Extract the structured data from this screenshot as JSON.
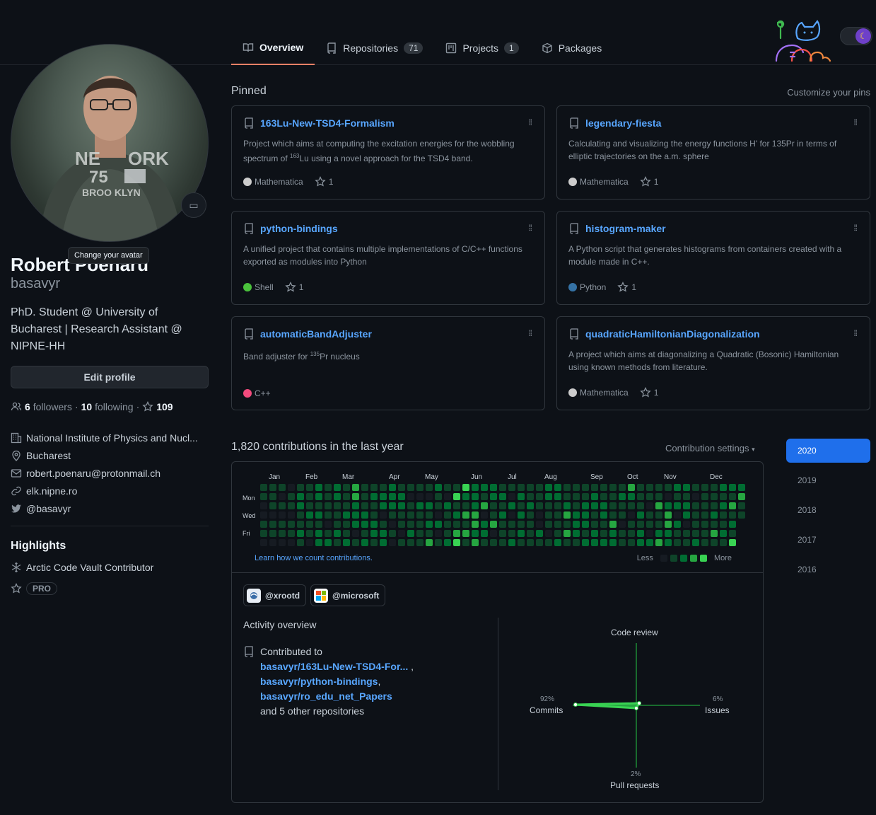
{
  "tabs": [
    {
      "label": "Overview",
      "count": ""
    },
    {
      "label": "Repositories",
      "count": "71"
    },
    {
      "label": "Projects",
      "count": "1"
    },
    {
      "label": "Packages",
      "count": ""
    }
  ],
  "profile": {
    "tooltip": "Change your avatar",
    "fullname": "Robert Poenaru",
    "username": "basavyr",
    "bio": "PhD. Student @ University of Bucharest | Research Assistant @ NIPNE-HH",
    "edit_label": "Edit profile",
    "followers": "6",
    "followers_label": "followers",
    "following": "10",
    "following_label": "following",
    "stars": "109",
    "org": "National Institute of Physics and Nucl...",
    "location": "Bucharest",
    "email": "robert.poenaru@protonmail.ch",
    "website": "elk.nipne.ro",
    "twitter": "@basavyr"
  },
  "highlights": {
    "title": "Highlights",
    "vault": "Arctic Code Vault Contributor",
    "pro": "PRO"
  },
  "pinned": {
    "title": "Pinned",
    "customize": "Customize your pins",
    "items": [
      {
        "name": "163Lu-New-TSD4-Formalism",
        "desc_a": "Project which aims at computing the excitation energies for the wobbling spectrum of ",
        "desc_sup": "163",
        "desc_b": "Lu using a novel approach for the TSD4 band.",
        "lang": "Mathematica",
        "color": "#cccccc",
        "stars": "1"
      },
      {
        "name": "legendary-fiesta",
        "desc_a": "Calculating and visualizing the energy functions H' for 135Pr in terms of elliptic trajectories on the a.m. sphere",
        "desc_sup": "",
        "desc_b": "",
        "lang": "Mathematica",
        "color": "#cccccc",
        "stars": "1"
      },
      {
        "name": "python-bindings",
        "desc_a": "A unified project that contains multiple implementations of C/C++ functions exported as modules into Python",
        "desc_sup": "",
        "desc_b": "",
        "lang": "Shell",
        "color": "#4ac23c",
        "stars": "1"
      },
      {
        "name": "histogram-maker",
        "desc_a": "A Python script that generates histograms from containers created with a module made in C++.",
        "desc_sup": "",
        "desc_b": "",
        "lang": "Python",
        "color": "#3572a5",
        "stars": "1"
      },
      {
        "name": "automaticBandAdjuster",
        "desc_a": "Band adjuster for ",
        "desc_sup": "135",
        "desc_b": "Pr nucleus",
        "lang": "C++",
        "color": "#f34b7d",
        "stars": ""
      },
      {
        "name": "quadraticHamiltonianDiagonalization",
        "desc_a": "A project which aims at diagonalizing a Quadratic (Bosonic) Hamiltonian using known methods from literature.",
        "desc_sup": "",
        "desc_b": "",
        "lang": "Mathematica",
        "color": "#cccccc",
        "stars": "1"
      }
    ]
  },
  "contributions": {
    "title": "1,820 contributions in the last year",
    "settings": "Contribution settings",
    "months": [
      "Jan",
      "Feb",
      "Mar",
      "Apr",
      "May",
      "Jun",
      "Jul",
      "Aug",
      "Sep",
      "Oct",
      "Nov",
      "Dec"
    ],
    "days": [
      "Mon",
      "Wed",
      "Fri"
    ],
    "learn": "Learn how we count contributions.",
    "less": "Less",
    "more": "More",
    "legend_colors": [
      "#161b22",
      "#0e4429",
      "#006d32",
      "#26a641",
      "#39d353"
    ]
  },
  "orgs": [
    {
      "name": "@xrootd"
    },
    {
      "name": "@microsoft"
    }
  ],
  "activity": {
    "title": "Activity overview",
    "contributed_to": "Contributed to",
    "repo1": "basavyr/163Lu-New-TSD4-For...",
    "repo2": "basavyr/python-bindings",
    "repo3": "basavyr/ro_edu_net_Papers",
    "others": "and 5 other repositories",
    "code_review": "Code review",
    "commits_pct": "92%",
    "commits": "Commits",
    "issues_pct": "6%",
    "issues": "Issues",
    "pr_pct": "2%",
    "pr": "Pull requests"
  },
  "years": [
    "2020",
    "2019",
    "2018",
    "2017",
    "2016"
  ]
}
